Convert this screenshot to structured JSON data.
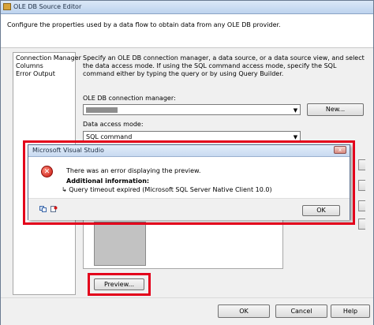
{
  "window": {
    "title": "OLE DB Source Editor"
  },
  "description": "Configure the properties used by a data flow to obtain data from any OLE DB provider.",
  "nav": {
    "items": [
      "Connection Manager",
      "Columns",
      "Error Output"
    ]
  },
  "instructions": "Specify an OLE DB connection manager, a data source, or a data source view, and select the data access mode. If using the SQL command access mode, specify the SQL command either by typing the query or by using Query Builder.",
  "connection": {
    "label": "OLE DB connection manager:",
    "new_button": "New..."
  },
  "access_mode": {
    "label": "Data access mode:",
    "value": "SQL command"
  },
  "preview_button": "Preview...",
  "footer": {
    "ok": "OK",
    "cancel": "Cancel",
    "help": "Help"
  },
  "dialog": {
    "title": "Microsoft Visual Studio",
    "close_glyph": "x",
    "message": "There was an error displaying the preview.",
    "additional_label": "Additional information:",
    "detail_arrow": "↳",
    "detail": "Query timeout expired (Microsoft SQL Server Native Client 10.0)",
    "ok": "OK"
  },
  "colors": {
    "highlight_outline": "#e3001b",
    "error_icon": "#c4120a"
  }
}
